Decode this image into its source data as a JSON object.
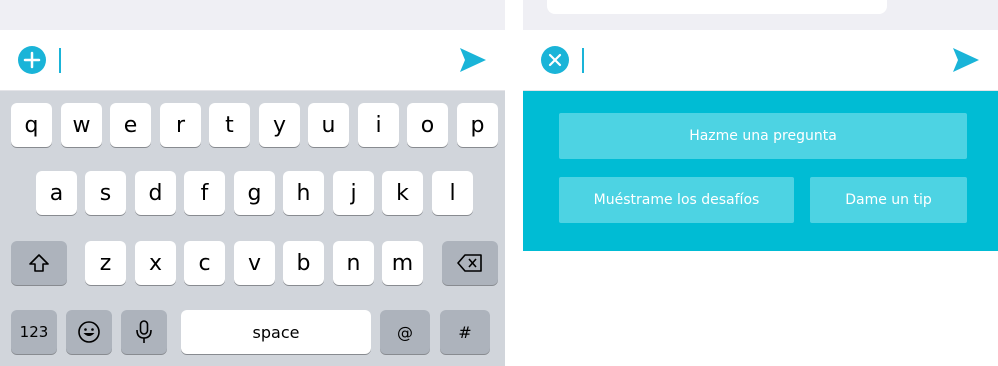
{
  "colors": {
    "accent": "#1ab4d8",
    "chip_panel": "#00bcd4",
    "chip": "#4dd3e3",
    "keyboard_bg": "#d1d5db"
  },
  "left": {
    "add_icon": "plus-circle-icon",
    "send_icon": "send-arrow-icon",
    "keyboard": {
      "row1": [
        "q",
        "w",
        "e",
        "r",
        "t",
        "y",
        "u",
        "i",
        "o",
        "p"
      ],
      "row2": [
        "a",
        "s",
        "d",
        "f",
        "g",
        "h",
        "j",
        "k",
        "l"
      ],
      "row3": [
        "z",
        "x",
        "c",
        "v",
        "b",
        "n",
        "m"
      ],
      "shift_icon": "shift-arrow-icon",
      "backspace_icon": "backspace-icon",
      "numbers_label": "123",
      "emoji_icon": "emoji-icon",
      "mic_icon": "microphone-icon",
      "space_label": "space",
      "at_label": "@",
      "hash_label": "#"
    }
  },
  "right": {
    "close_icon": "close-circle-icon",
    "send_icon": "send-arrow-icon",
    "chips": {
      "ask": "Hazme una pregunta",
      "challenges": "Muéstrame los desafíos",
      "tip": "Dame un tip"
    }
  }
}
